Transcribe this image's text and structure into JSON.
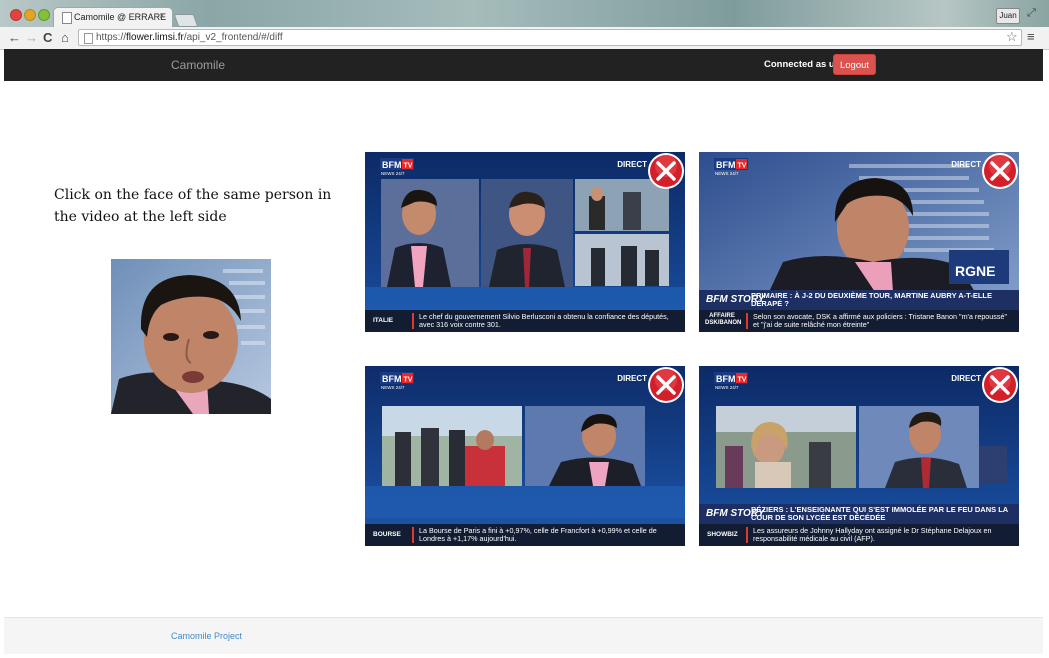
{
  "browser": {
    "tab_title": "Camomile @ ERRARE",
    "tab_close": "×",
    "url_prefix": "https://",
    "url_host": "flower.limsi.fr",
    "url_path": "/api_v2_frontend/#/diff",
    "user_badge": "Juan",
    "nav_back": "←",
    "nav_forward": "→",
    "nav_reload": "C",
    "nav_home": "⌂",
    "star": "☆",
    "menu": "≡",
    "fullscreen": "⤢"
  },
  "navbar": {
    "brand": "Camomile",
    "connected_label": "Connected as u1",
    "logout_label": "Logout",
    "logout_color": "#d9534f",
    "background": "#222222"
  },
  "main": {
    "instruction": "Click on the face of the same person in the video at the left side",
    "candidates": [
      {
        "live": "DIRECT",
        "ticker_category": "ITALIE",
        "ticker_text": "Le chef du gouvernement Silvio Berlusconi a obtenu la confiance des députés, avec 316 voix contre 301."
      },
      {
        "live": "DIRECT",
        "story_label": "BFM STORY",
        "headline": "PRIMAIRE : À J-2 DU DEUXIÈME TOUR, MARTINE AUBRY A-T-ELLE DÉRAPÉ ?",
        "ticker_category": "AFFAIRE DSK/BANON",
        "ticker_text": "Selon son avocate, DSK a affirmé aux policiers : Tristane Banon \"m'a repoussé\" et \"j'ai de suite relâché mon étreinte\""
      },
      {
        "live": "DIRECT",
        "ticker_category": "BOURSE",
        "ticker_text": "La Bourse de Paris a fini à +0,97%, celle de Francfort à +0,99% et celle de Londres à +1,17% aujourd'hui."
      },
      {
        "live": "DIRECT",
        "story_label": "BFM STORY",
        "headline": "BÉZIERS : L'ENSEIGNANTE QUI S'EST IMMOLÉE PAR LE FEU DANS LA COUR DE SON LYCÉE EST DÉCÉDÉE",
        "ticker_category": "SHOWBIZ",
        "ticker_text": "Les assureurs de Johnny Hallyday ont assigné le Dr Stéphane Delajoux en responsabilité médicale au civil (AFP)."
      }
    ],
    "logo_text": "BFM TV"
  },
  "footer": {
    "link": "Camomile Project"
  }
}
